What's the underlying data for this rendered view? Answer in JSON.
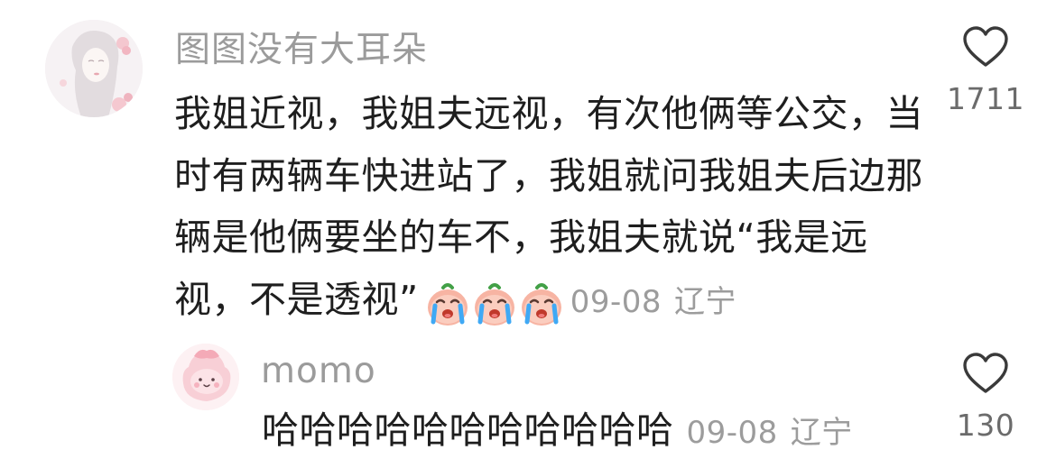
{
  "main_comment": {
    "username": "图图没有大耳朵",
    "text": "我姐近视，我姐夫远视，有次他俩等公交，当时有两辆车快进站了，我姐就问我姐夫后边那辆是他俩要坐的车不，我姐夫就说“我是远视，不是透视”",
    "emojis": [
      "crying-emoji",
      "crying-emoji",
      "crying-emoji"
    ],
    "date": "09-08",
    "location": "辽宁",
    "like_icon": "heart-outline-icon",
    "like_count": "1711"
  },
  "reply": {
    "username": "momo",
    "text": "哈哈哈哈哈哈哈哈哈哈哈",
    "date": "09-08",
    "location": "辽宁",
    "like_icon": "heart-outline-icon",
    "like_count": "130"
  },
  "colors": {
    "username": "#9b9b9b",
    "text": "#1e1e1e",
    "meta": "#9c9c9c",
    "like_count": "#6b6b6b",
    "heart_stroke": "#3a3a3a"
  }
}
